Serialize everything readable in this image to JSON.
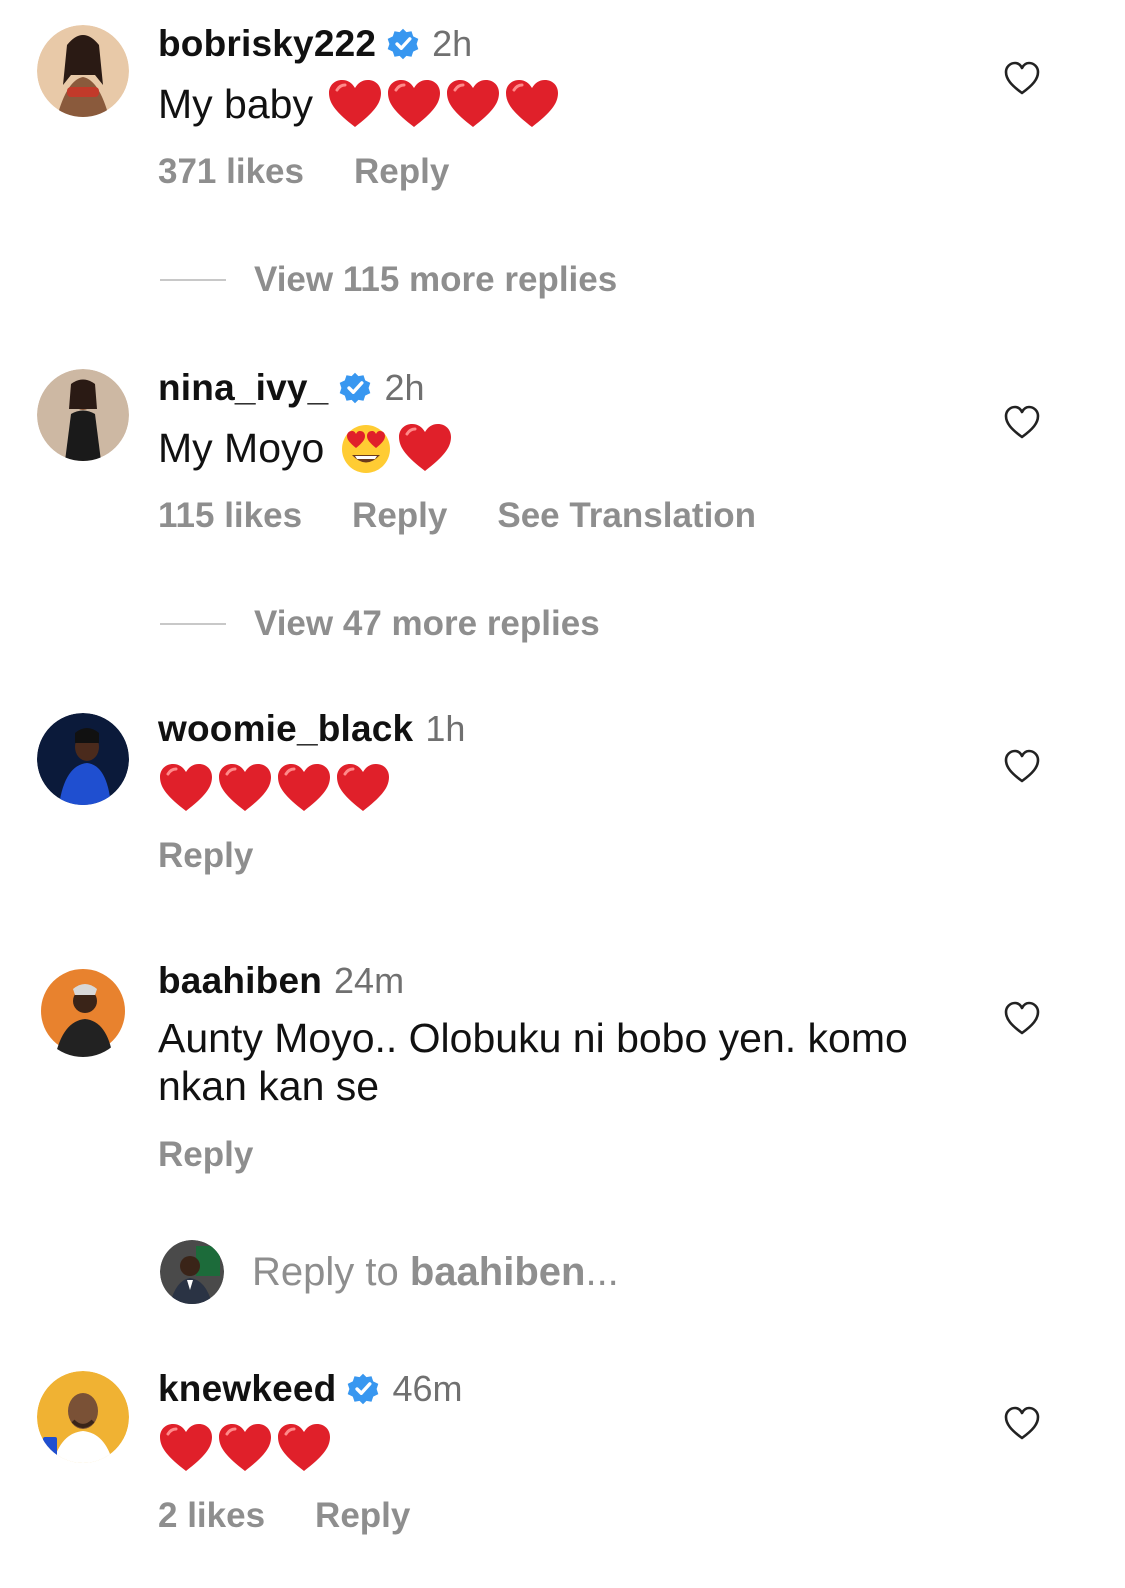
{
  "comments": [
    {
      "username": "bobrisky222",
      "verified": true,
      "time": "2h",
      "text": "My baby",
      "emojis": [
        "red-heart",
        "red-heart",
        "red-heart",
        "red-heart"
      ],
      "likes": "371 likes",
      "reply": "Reply",
      "avatar_colors": [
        "#e8c9a8",
        "#c23a2a"
      ]
    },
    {
      "username": "nina_ivy_",
      "verified": true,
      "time": "2h",
      "text": "My Moyo",
      "emojis": [
        "heart-eyes",
        "red-heart"
      ],
      "likes": "115 likes",
      "reply": "Reply",
      "translation": "See Translation",
      "avatar_colors": [
        "#cdb8a3",
        "#1a1a1a"
      ]
    },
    {
      "username": "woomie_black",
      "verified": false,
      "time": "1h",
      "text": "",
      "emojis": [
        "red-heart",
        "red-heart",
        "red-heart",
        "red-heart"
      ],
      "reply": "Reply",
      "avatar_colors": [
        "#0b1a3a",
        "#1f4fd0"
      ]
    },
    {
      "username": "baahiben",
      "verified": false,
      "time": "24m",
      "text": "Aunty Moyo.. Olobuku ni bobo yen. komo nkan kan se",
      "emojis": [],
      "reply": "Reply",
      "avatar_colors": [
        "#e8822e",
        "#2a2a2a"
      ]
    },
    {
      "username": "knewkeed",
      "verified": true,
      "time": "46m",
      "text": "",
      "emojis": [
        "red-heart",
        "red-heart",
        "red-heart"
      ],
      "likes": "2 likes",
      "reply": "Reply",
      "avatar_colors": [
        "#f0b233",
        "#7a5136"
      ]
    }
  ],
  "view_replies": [
    "View 115 more replies",
    "View 47 more replies"
  ],
  "reply_to": {
    "prefix": "Reply to ",
    "username": "baahiben",
    "suffix": "..."
  },
  "colors": {
    "verified": "#3897f0",
    "muted": "#8e8e8e",
    "heart": "#e0202a"
  }
}
